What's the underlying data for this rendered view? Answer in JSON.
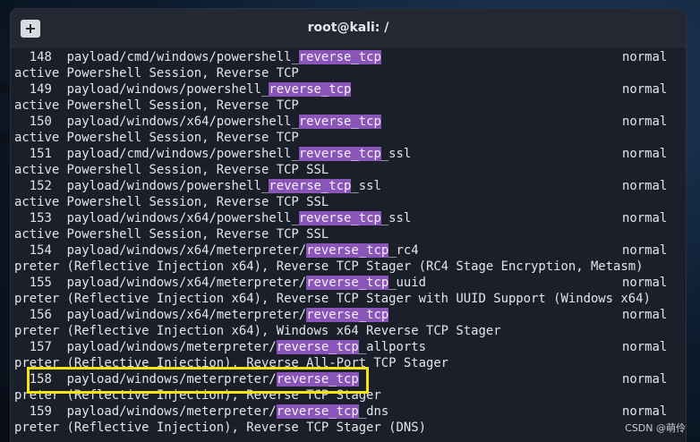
{
  "window": {
    "title": "root@kali: /",
    "new_tab_icon": "plus-box-icon"
  },
  "highlight_color": "#8a55b8",
  "selection_box_color": "#f5e30f",
  "rows": [
    {
      "num": "148",
      "pre": "payload/cmd/windows/powershell_",
      "match": "reverse_tcp",
      "post": "",
      "status": "normal",
      "desc": "active Powershell Session, Reverse TCP"
    },
    {
      "num": "149",
      "pre": "payload/windows/powershell_",
      "match": "reverse_tcp",
      "post": "",
      "status": "normal",
      "desc": "active Powershell Session, Reverse TCP"
    },
    {
      "num": "150",
      "pre": "payload/windows/x64/powershell_",
      "match": "reverse_tcp",
      "post": "",
      "status": "normal",
      "desc": "active Powershell Session, Reverse TCP"
    },
    {
      "num": "151",
      "pre": "payload/cmd/windows/powershell_",
      "match": "reverse_tcp",
      "post": "_ssl",
      "status": "normal",
      "desc": "active Powershell Session, Reverse TCP SSL"
    },
    {
      "num": "152",
      "pre": "payload/windows/powershell_",
      "match": "reverse_tcp",
      "post": "_ssl",
      "status": "normal",
      "desc": "active Powershell Session, Reverse TCP SSL"
    },
    {
      "num": "153",
      "pre": "payload/windows/x64/powershell_",
      "match": "reverse_tcp",
      "post": "_ssl",
      "status": "normal",
      "desc": "active Powershell Session, Reverse TCP SSL"
    },
    {
      "num": "154",
      "pre": "payload/windows/x64/meterpreter/",
      "match": "reverse_tcp",
      "post": "_rc4",
      "status": "normal",
      "desc": "preter (Reflective Injection x64), Reverse TCP Stager (RC4 Stage Encryption, Metasm)"
    },
    {
      "num": "155",
      "pre": "payload/windows/x64/meterpreter/",
      "match": "reverse_tcp",
      "post": "_uuid",
      "status": "normal",
      "desc": "preter (Reflective Injection x64), Reverse TCP Stager with UUID Support (Windows x64)"
    },
    {
      "num": "156",
      "pre": "payload/windows/x64/meterpreter/",
      "match": "reverse_tcp",
      "post": "",
      "status": "normal",
      "desc": "preter (Reflective Injection x64), Windows x64 Reverse TCP Stager"
    },
    {
      "num": "157",
      "pre": "payload/windows/meterpreter/",
      "match": "reverse_tcp",
      "post": "_allports",
      "status": "normal",
      "desc": "preter (Reflective Injection), Reverse All-Port TCP Stager"
    },
    {
      "num": "158",
      "pre": "payload/windows/meterpreter/",
      "match": "reverse_tcp",
      "post": "",
      "status": "normal",
      "desc": "preter (Reflective Injection), Reverse TCP Stager"
    },
    {
      "num": "159",
      "pre": "payload/windows/meterpreter/",
      "match": "reverse_tcp",
      "post": "_dns",
      "status": "normal",
      "desc": "preter (Reflective Injection), Reverse TCP Stager (DNS)"
    }
  ],
  "watermark": "CSDN @萌伶"
}
